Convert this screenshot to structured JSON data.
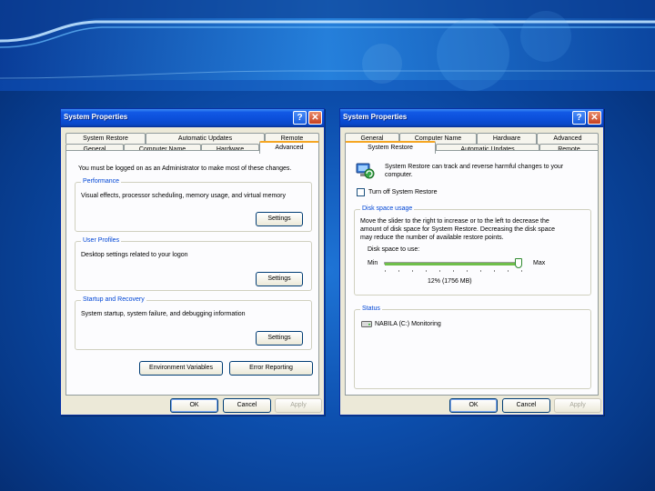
{
  "left_window": {
    "title": "System Properties",
    "tabs_back": [
      "System Restore",
      "Automatic Updates",
      "Remote"
    ],
    "tabs_front": [
      "General",
      "Computer Name",
      "Hardware",
      "Advanced"
    ],
    "admin_note": "You must be logged on as an Administrator to make most of these changes.",
    "performance": {
      "title": "Performance",
      "desc": "Visual effects, processor scheduling, memory usage, and virtual memory",
      "button": "Settings"
    },
    "user_profiles": {
      "title": "User Profiles",
      "desc": "Desktop settings related to your logon",
      "button": "Settings"
    },
    "startup": {
      "title": "Startup and Recovery",
      "desc": "System startup, system failure, and debugging information",
      "button": "Settings"
    },
    "env_button": "Environment Variables",
    "error_button": "Error Reporting",
    "ok": "OK",
    "cancel": "Cancel",
    "apply": "Apply"
  },
  "right_window": {
    "title": "System Properties",
    "tabs_back": [
      "General",
      "Computer Name",
      "Hardware",
      "Advanced"
    ],
    "tabs_front": [
      "System Restore",
      "Automatic Updates",
      "Remote"
    ],
    "intro_line1": "System Restore can track and reverse harmful changes to your",
    "intro_line2": "computer.",
    "turn_off": "Turn off System Restore",
    "disk_group": "Disk space usage",
    "disk_desc1": "Move the slider to the right to increase or to the left to decrease the",
    "disk_desc2": "amount of disk space for System Restore. Decreasing the disk space",
    "disk_desc3": "may reduce the number of available restore points.",
    "disk_label": "Disk space to use:",
    "min_label": "Min",
    "max_label": "Max",
    "slider_level": 0.98,
    "slider_value": "12% (1756 MB)",
    "status_group": "Status",
    "status_text": "NABILA (C:) Monitoring",
    "ok": "OK",
    "cancel": "Cancel",
    "apply": "Apply"
  },
  "colors": {
    "title_blue": "#0b4ed8",
    "dialog_face": "#ece9d8",
    "group_title": "#0046d5",
    "tab_accent": "#f5a623"
  }
}
